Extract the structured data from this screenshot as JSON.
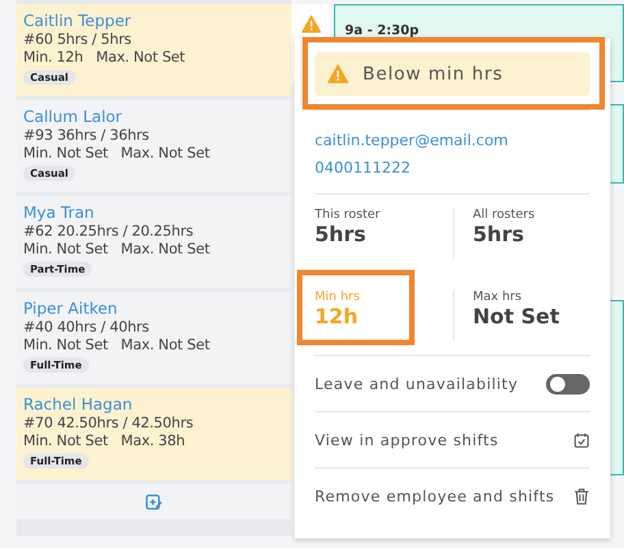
{
  "employees": [
    {
      "name": "Caitlin Tepper",
      "hours": "#60 5hrs / 5hrs",
      "limits": "Min. 12h   Max. Not Set",
      "type": "Casual",
      "highlighted": true
    },
    {
      "name": "Callum Lalor",
      "hours": "#93 36hrs / 36hrs",
      "limits": "Min. Not Set   Max. Not Set",
      "type": "Casual",
      "highlighted": false
    },
    {
      "name": "Mya Tran",
      "hours": "#62 20.25hrs / 20.25hrs",
      "limits": "Min. Not Set   Max. Not Set",
      "type": "Part-Time",
      "highlighted": false
    },
    {
      "name": "Piper Aitken",
      "hours": "#40 40hrs / 40hrs",
      "limits": "Min. Not Set   Max. Not Set",
      "type": "Full-Time",
      "highlighted": false
    },
    {
      "name": "Rachel Hagan",
      "hours": "#70 42.50hrs / 42.50hrs",
      "limits": "Min. Not Set   Max. 38h",
      "type": "Full-Time",
      "highlighted": true
    }
  ],
  "shift": {
    "time": "9a - 2:30p"
  },
  "popup": {
    "warning": "Below min hrs",
    "email": "caitlin.tepper@email.com",
    "phone": "0400111222",
    "stats": [
      {
        "label": "This roster",
        "value": "5hrs",
        "warning": false
      },
      {
        "label": "All rosters",
        "value": "5hrs",
        "warning": false
      },
      {
        "label": "Min hrs",
        "value": "12h",
        "warning": true
      },
      {
        "label": "Max hrs",
        "value": "Not Set",
        "warning": false
      }
    ],
    "actions": [
      {
        "kind": "toggle",
        "label": "Leave and unavailability",
        "on": false
      },
      {
        "kind": "calendar",
        "label": "View in approve shifts"
      },
      {
        "kind": "delete",
        "label": "Remove employee and shifts"
      }
    ]
  }
}
